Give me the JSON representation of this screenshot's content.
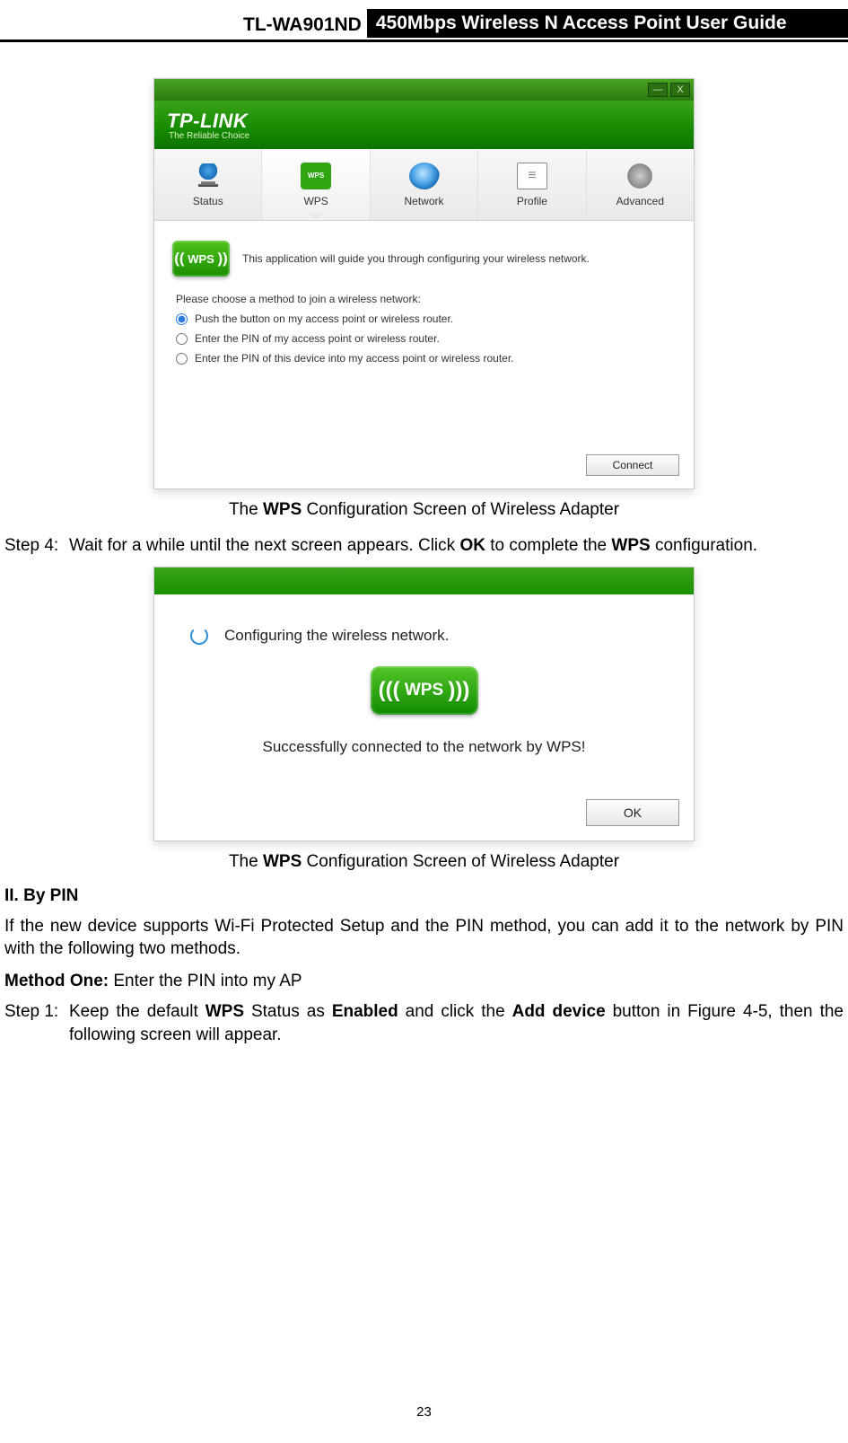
{
  "header": {
    "model": "TL-WA901ND",
    "title": "450Mbps Wireless N Access Point User Guide"
  },
  "figure1": {
    "window": {
      "minimize": "—",
      "close": "X",
      "brand": "TP-LINK",
      "brand_sub": "The Reliable Choice"
    },
    "tabs": {
      "status": "Status",
      "wps": "WPS",
      "network": "Network",
      "profile": "Profile",
      "advanced": "Advanced"
    },
    "wps_badge": "WPS",
    "intro_text": "This application will guide you through configuring your wireless network.",
    "prompt": "Please choose a method to join a wireless network:",
    "options": {
      "opt1": "Push the button on my access point or wireless router.",
      "opt2": "Enter the PIN of my access point or wireless router.",
      "opt3": "Enter the PIN of this device into my access point or wireless router."
    },
    "connect_button": "Connect"
  },
  "caption1": {
    "pre": "The ",
    "bold": "WPS",
    "post": " Configuration Screen of Wireless Adapter"
  },
  "step4": {
    "label": "Step 4:",
    "t1": "Wait for a while until the next screen appears. Click ",
    "b1": "OK",
    "t2": " to complete the ",
    "b2": "WPS",
    "t3": " configuration."
  },
  "figure2": {
    "configuring": "Configuring the wireless network.",
    "wps_badge": "WPS",
    "success": "Successfully connected to the network by WPS!",
    "ok_button": "OK"
  },
  "caption2": {
    "pre": "The ",
    "bold": "WPS",
    "post": " Configuration Screen of Wireless Adapter"
  },
  "section2_title": "II.   By PIN",
  "section2_para": "If the new device supports Wi-Fi Protected Setup and the PIN method, you can add it to the network by PIN with the following two methods.",
  "method1": {
    "bold": "Method One:",
    "rest": " Enter the PIN into my AP"
  },
  "step1": {
    "label": "Step 1:",
    "t1": "Keep the default ",
    "b1": "WPS",
    "t2": " Status as ",
    "b2": "Enabled",
    "t3": " and click the ",
    "b3": "Add device",
    "t4": " button in Figure 4-5, then the following screen will appear."
  },
  "page_number": "23"
}
